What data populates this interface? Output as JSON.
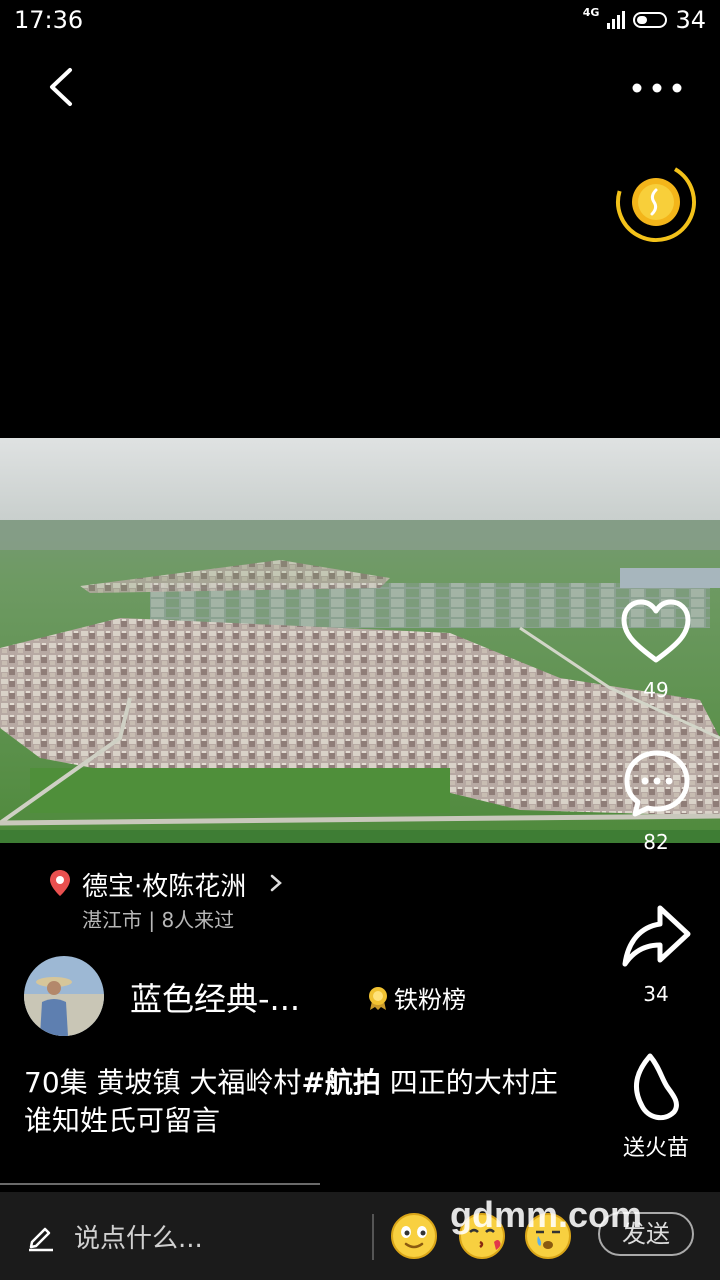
{
  "status_bar": {
    "time": "17:36",
    "network": "4G",
    "battery": "34"
  },
  "location": {
    "title": "德宝·枚陈花洲",
    "subtitle": "湛江市 | 8人来过"
  },
  "author": {
    "name": "蓝色经典-...",
    "badge": "铁粉榜"
  },
  "caption": {
    "prefix": "70集 黄坡镇  大福岭村",
    "hashtag": "#航拍",
    "suffix": "  四正的大村庄 谁知姓氏可留言"
  },
  "actions": {
    "likes": "49",
    "comments": "82",
    "shares": "34",
    "gift_label": "送火苗"
  },
  "bottom_bar": {
    "comment_placeholder": "说点什么...",
    "send_label": "发送"
  },
  "watermark": "gdmm.com",
  "colors": {
    "coin": "#f3c21a",
    "location_pin": "#e9504f"
  }
}
